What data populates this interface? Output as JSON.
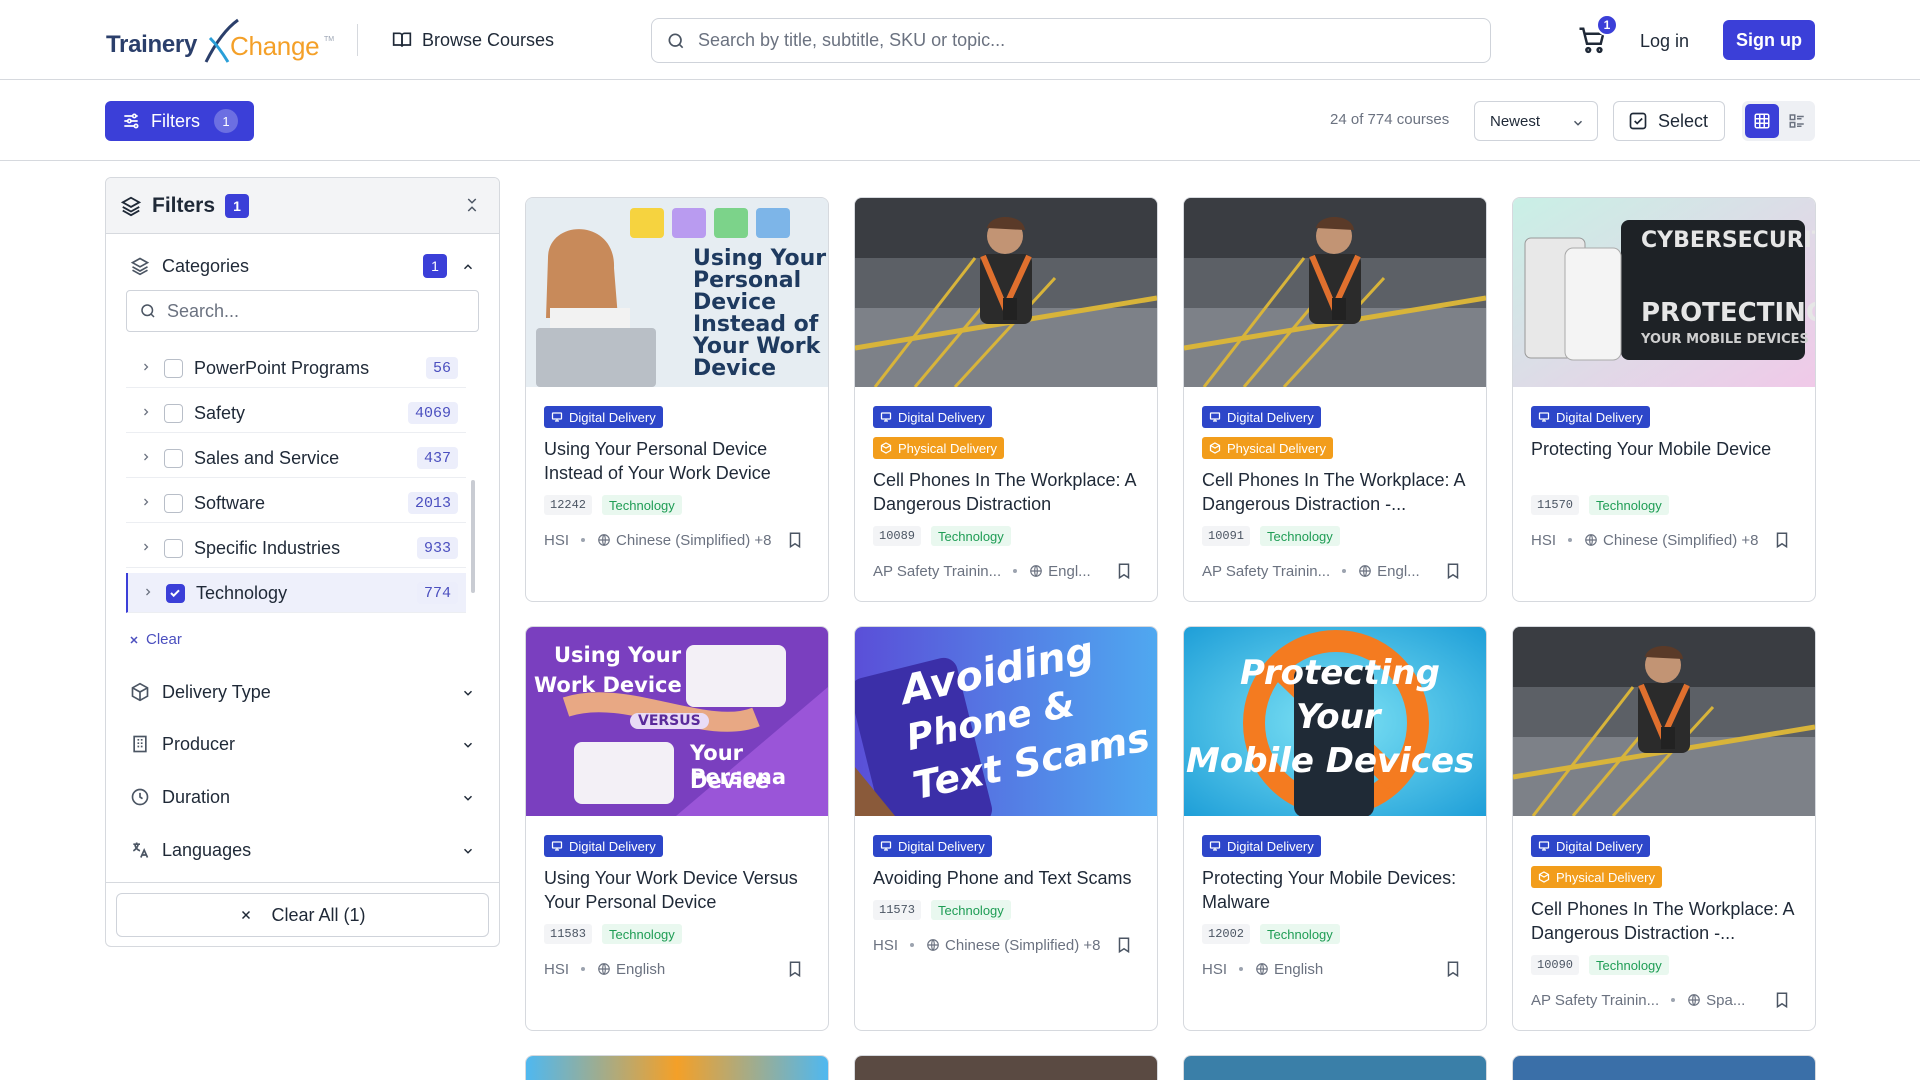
{
  "header": {
    "logo_part1": "Trainery",
    "logo_part2": "Change",
    "logo_tm": "TM",
    "browse_label": "Browse Courses",
    "search_placeholder": "Search by title, subtitle, SKU or topic...",
    "cart_count": "1",
    "login_label": "Log in",
    "signup_label": "Sign up",
    "accent": "#3b3fd8"
  },
  "toolbar": {
    "filters_label": "Filters",
    "filters_count": "1",
    "result_count": "24 of 774 courses",
    "sort_value": "Newest",
    "select_label": "Select"
  },
  "sidebar": {
    "title": "Filters",
    "count": "1",
    "categories_label": "Categories",
    "categories_count": "1",
    "category_search_placeholder": "Search...",
    "items": [
      {
        "label": "PowerPoint Programs",
        "count": "56",
        "checked": false
      },
      {
        "label": "Safety",
        "count": "4069",
        "checked": false
      },
      {
        "label": "Sales and Service",
        "count": "437",
        "checked": false
      },
      {
        "label": "Software",
        "count": "2013",
        "checked": false
      },
      {
        "label": "Specific Industries",
        "count": "933",
        "checked": false
      },
      {
        "label": "Technology",
        "count": "774",
        "checked": true
      }
    ],
    "clear_label": "Clear",
    "sections": [
      "Delivery Type",
      "Producer",
      "Duration",
      "Languages"
    ],
    "clear_all_label": "Clear All (1)"
  },
  "cards": [
    {
      "thumb_lines": [
        "Using Your",
        "Personal",
        "Device",
        "Instead of",
        "Your Work",
        "Device"
      ],
      "digital": "Digital Delivery",
      "physical": "",
      "title": "Using Your Personal Device Instead of Your Work Device",
      "sku": "12242",
      "topic": "Technology",
      "producer": "HSI",
      "language": "Chinese (Simplified) +8"
    },
    {
      "thumb_lines": [],
      "digital": "Digital Delivery",
      "physical": "Physical Delivery",
      "title": "Cell Phones In The Workplace: A Dangerous Distraction",
      "sku": "10089",
      "topic": "Technology",
      "producer": "AP Safety Trainin...",
      "language": "Engl..."
    },
    {
      "thumb_lines": [],
      "digital": "Digital Delivery",
      "physical": "Physical Delivery",
      "title": "Cell Phones In The Workplace: A Dangerous Distraction -...",
      "sku": "10091",
      "topic": "Technology",
      "producer": "AP Safety Trainin...",
      "language": "Engl..."
    },
    {
      "thumb_lines": [
        "CYBERSECURITY",
        "PROTECTING",
        "YOUR MOBILE DEVICES"
      ],
      "digital": "Digital Delivery",
      "physical": "",
      "title": "Protecting Your Mobile Device",
      "sku": "11570",
      "topic": "Technology",
      "producer": "HSI",
      "language": "Chinese (Simplified) +8"
    },
    {
      "thumb_lines": [
        "Using Your",
        "Work Device",
        "VERSUS",
        "Your Persona",
        "Device"
      ],
      "digital": "Digital Delivery",
      "physical": "",
      "title": "Using Your Work Device Versus Your Personal Device",
      "sku": "11583",
      "topic": "Technology",
      "producer": "HSI",
      "language": "English"
    },
    {
      "thumb_lines": [
        "Avoiding",
        "Phone &",
        "Text Scams"
      ],
      "digital": "Digital Delivery",
      "physical": "",
      "title": "Avoiding Phone and Text Scams",
      "sku": "11573",
      "topic": "Technology",
      "producer": "HSI",
      "language": "Chinese (Simplified) +8"
    },
    {
      "thumb_lines": [
        "Protecting",
        "Your",
        "Mobile Devices"
      ],
      "digital": "Digital Delivery",
      "physical": "",
      "title": "Protecting Your Mobile Devices: Malware",
      "sku": "12002",
      "topic": "Technology",
      "producer": "HSI",
      "language": "English"
    },
    {
      "thumb_lines": [],
      "digital": "Digital Delivery",
      "physical": "Physical Delivery",
      "title": "Cell Phones In The Workplace: A Dangerous Distraction -...",
      "sku": "10090",
      "topic": "Technology",
      "producer": "AP Safety Trainin...",
      "language": "Spa..."
    }
  ]
}
